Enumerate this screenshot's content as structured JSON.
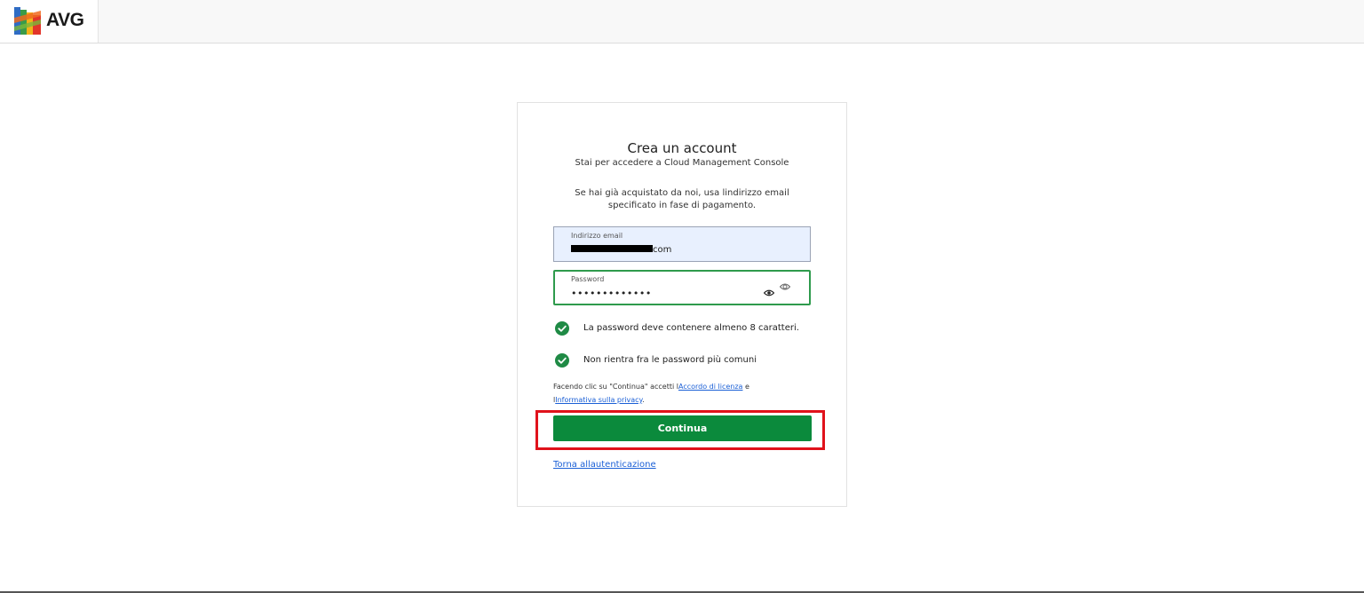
{
  "header": {
    "logo_text": "AVG",
    "logo_icon": "avg-logo-icon"
  },
  "card": {
    "title": "Crea un account",
    "subtitle": "Stai per accedere a Cloud Management Console",
    "info_line1": "Se hai già acquistato da noi, usa lindirizzo email",
    "info_line2": "specificato in fase di pagamento.",
    "email": {
      "label": "Indirizzo email",
      "value_suffix": "com"
    },
    "password": {
      "label": "Password",
      "value": "•••••••••••••"
    },
    "rules": [
      {
        "text": "La password deve contenere almeno 8 caratteri.",
        "status": "ok"
      },
      {
        "text": "Non rientra fra le password più comuni",
        "status": "ok"
      }
    ],
    "terms": {
      "prefix": "Facendo clic su \"Continua\" accetti l",
      "license_link": "Accordo di licenza",
      "middle": " e",
      "prefix2": "l",
      "privacy_link": "Informativa sulla privacy",
      "suffix": "."
    },
    "continue_label": "Continua",
    "back_link": "Torna allautenticazione"
  },
  "colors": {
    "brand_green": "#0b8a3c",
    "check_green": "#1f8a45",
    "highlight_red": "#e0121b",
    "link_blue": "#1a5fd6"
  }
}
